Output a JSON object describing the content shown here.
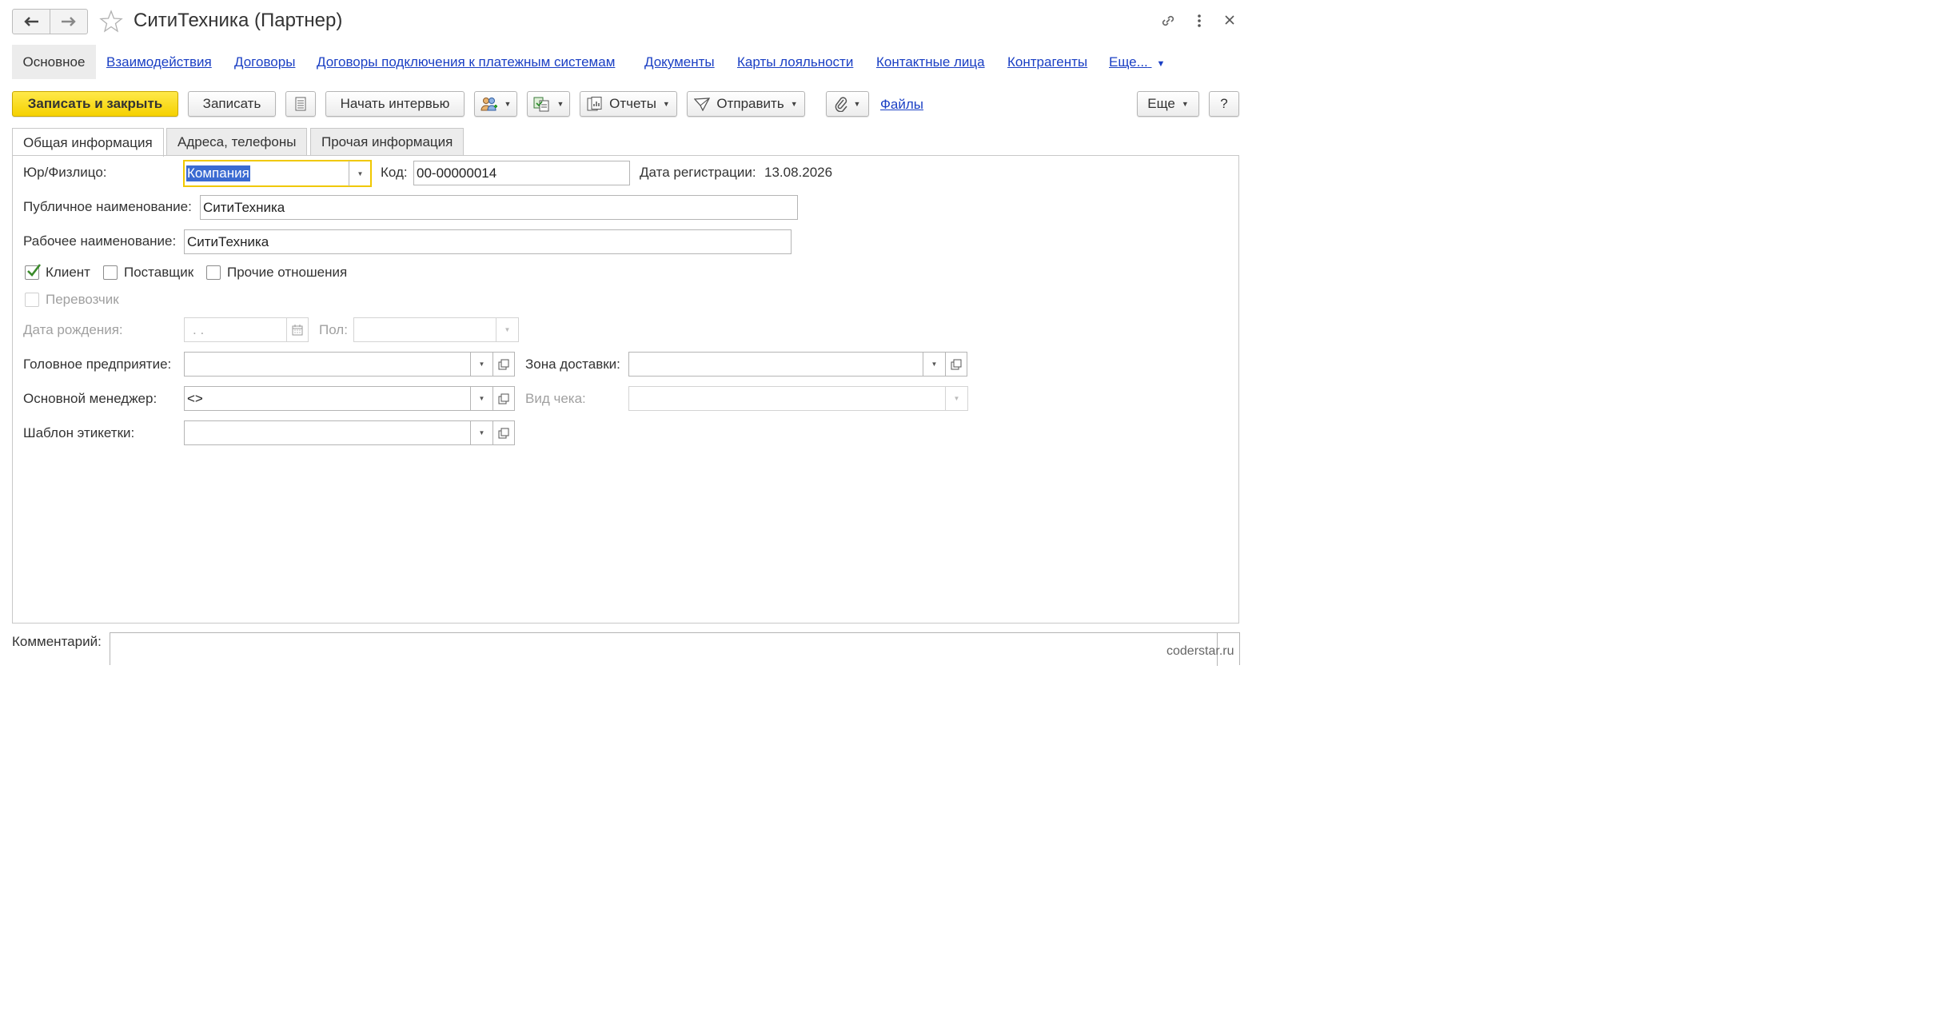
{
  "window": {
    "title": "СитиТехника (Партнер)"
  },
  "nav_tabs": {
    "active": "Основное",
    "links": [
      "Взаимодействия",
      "Договоры",
      "Договоры подключения к платежным системам",
      "Документы",
      "Карты лояльности",
      "Контактные лица",
      "Контрагенты"
    ],
    "more": "Еще..."
  },
  "toolbar": {
    "save_close": "Записать и закрыть",
    "save": "Записать",
    "start_interview": "Начать интервью",
    "reports": "Отчеты",
    "send": "Отправить",
    "files": "Файлы",
    "more": "Еще",
    "help": "?"
  },
  "form_tabs": [
    "Общая информация",
    "Адреса, телефоны",
    "Прочая информация"
  ],
  "fields": {
    "entity_type_label": "Юр/Физлицо:",
    "entity_type_value": "Компания",
    "code_label": "Код:",
    "code_value": "00-00000014",
    "reg_date_label": "Дата регистрации:",
    "reg_date_value": "13.08.2026",
    "public_name_label": "Публичное наименование:",
    "public_name_value": "СитиТехника",
    "work_name_label": "Рабочее наименование:",
    "work_name_value": "СитиТехника",
    "client_label": "Клиент",
    "supplier_label": "Поставщик",
    "other_rel_label": "Прочие отношения",
    "carrier_label": "Перевозчик",
    "birth_date_label": "Дата рождения:",
    "birth_date_value": " .  .",
    "gender_label": "Пол:",
    "head_company_label": "Головное предприятие:",
    "delivery_zone_label": "Зона доставки:",
    "manager_label": "Основной менеджер:",
    "manager_value": "<>",
    "receipt_type_label": "Вид чека:",
    "label_template_label": "Шаблон этикетки:"
  },
  "comment": {
    "label": "Комментарий:"
  },
  "watermark": "coderstar.ru",
  "colors": {
    "primary_button": "#f5d100",
    "link": "#1a3fc4",
    "focus_border": "#f0c800",
    "check": "#3a8a2a"
  }
}
